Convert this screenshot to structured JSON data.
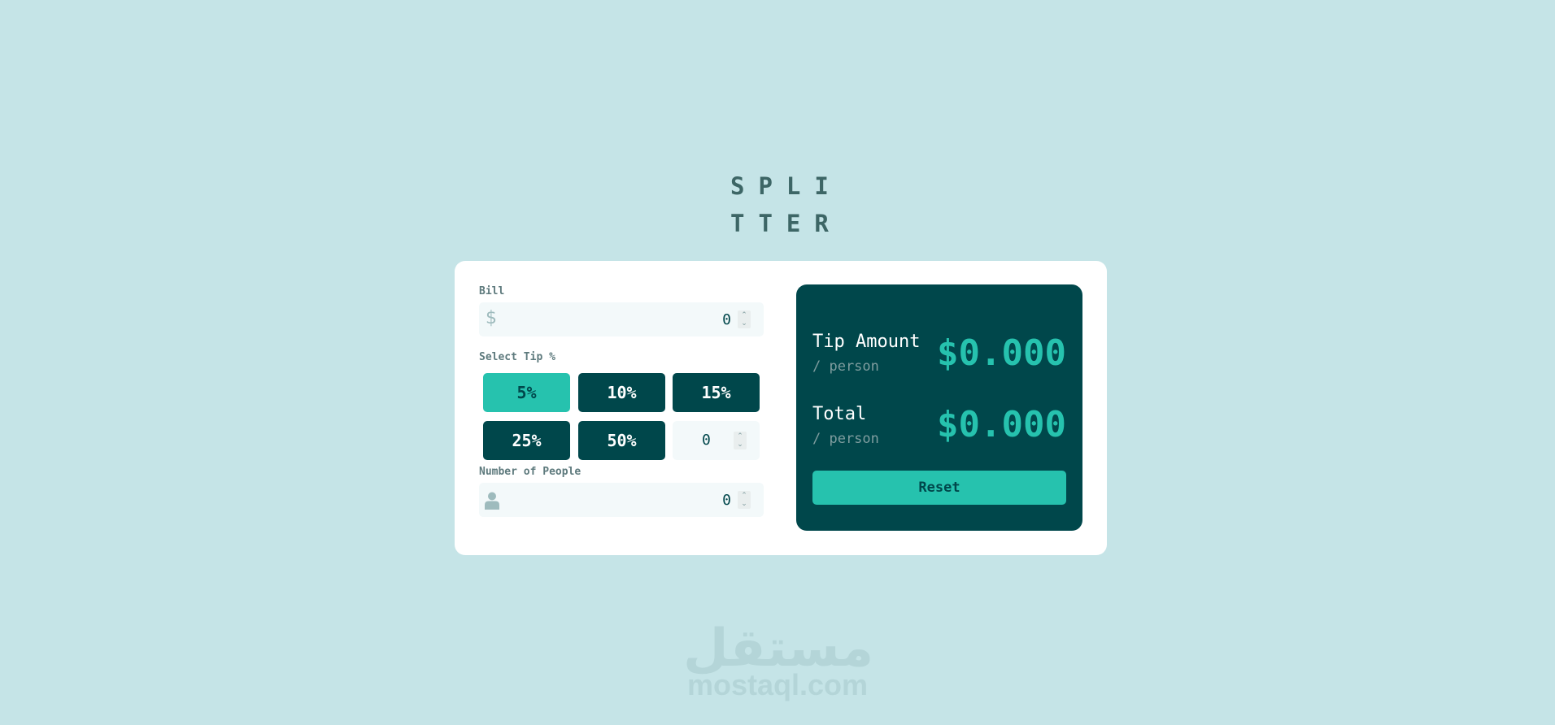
{
  "app": {
    "logo_line1": "SPLI",
    "logo_line2": "TTER"
  },
  "bill": {
    "label": "Bill",
    "prefix_icon": "dollar-icon",
    "value": "0"
  },
  "tip": {
    "label": "Select Tip %",
    "buttons": [
      "5%",
      "10%",
      "15%",
      "25%",
      "50%"
    ],
    "selected": "5%",
    "custom_value": "0"
  },
  "people": {
    "label": "Number of People",
    "prefix_icon": "person-icon",
    "value": "0"
  },
  "result": {
    "tip_title": "Tip Amount",
    "tip_sub": "/ person",
    "tip_value": "$0.000",
    "total_title": "Total",
    "total_sub": "/ person",
    "total_value": "$0.000",
    "reset_label": "Reset"
  },
  "watermark": {
    "arabic": "مستقل",
    "latin": "mostaql.com"
  },
  "colors": {
    "background": "#c5e4e7",
    "dark_cyan": "#00474b",
    "strong_cyan": "#26c2ae",
    "card": "#ffffff",
    "input_bg": "#f3f9fa"
  }
}
